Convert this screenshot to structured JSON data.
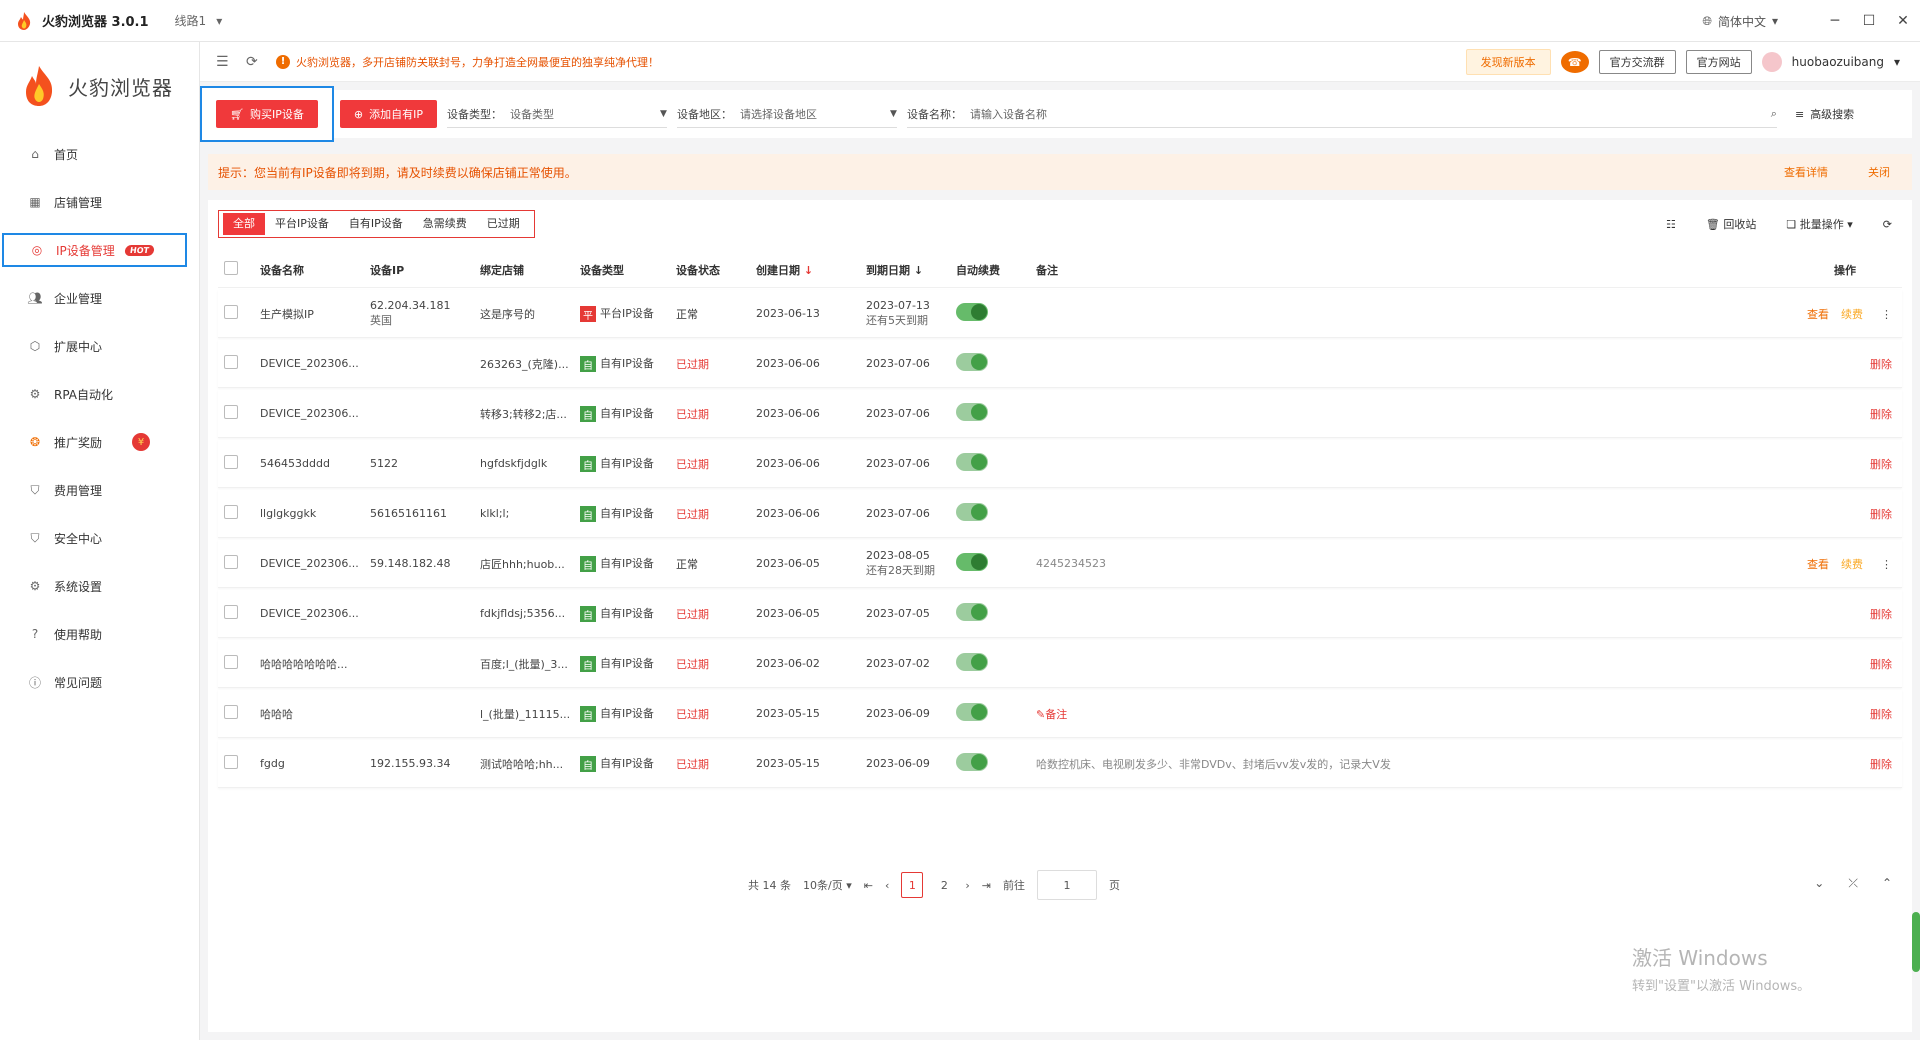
{
  "titlebar": {
    "app_title": "火豹浏览器 3.0.1",
    "route": "线路1",
    "language": "简体中文"
  },
  "brand": {
    "name": "火豹浏览器"
  },
  "sidebar": {
    "items": [
      {
        "label": "首页",
        "icon": "home-icon"
      },
      {
        "label": "店铺管理",
        "icon": "grid-icon"
      },
      {
        "label": "IP设备管理",
        "icon": "location-icon",
        "badge": "HOT"
      },
      {
        "label": "企业管理",
        "icon": "users-icon"
      },
      {
        "label": "扩展中心",
        "icon": "cube-icon"
      },
      {
        "label": "RPA自动化",
        "icon": "robot-icon"
      },
      {
        "label": "推广奖励",
        "icon": "gift-icon",
        "badge": "¥"
      },
      {
        "label": "费用管理",
        "icon": "shield-icon"
      },
      {
        "label": "安全中心",
        "icon": "shield-check-icon"
      },
      {
        "label": "系统设置",
        "icon": "settings-icon"
      },
      {
        "label": "使用帮助",
        "icon": "help-icon"
      },
      {
        "label": "常见问题",
        "icon": "info-icon"
      }
    ]
  },
  "topbar": {
    "notice": "火豹浏览器，多开店铺防关联封号，力争打造全网最便宜的独享纯净代理！",
    "new_version": "发现新版本",
    "group_btn": "官方交流群",
    "site_btn": "官方网站",
    "username": "huobaozuibang"
  },
  "toolbar": {
    "buy_btn": "购买IP设备",
    "add_btn": "添加自有IP",
    "type_label": "设备类型：",
    "type_value": "设备类型",
    "region_label": "设备地区：",
    "region_value": "请选择设备地区",
    "name_label": "设备名称：",
    "name_placeholder": "请输入设备名称",
    "advanced": "高级搜索"
  },
  "alert": {
    "text": "提示：您当前有IP设备即将到期，请及时续费以确保店铺正常使用。",
    "details": "查看详情",
    "close": "关闭"
  },
  "tabs": [
    "全部",
    "平台IP设备",
    "自有IP设备",
    "急需续费",
    "已过期"
  ],
  "panel_tools": {
    "recycle": "回收站",
    "batch": "批量操作"
  },
  "table": {
    "headers": [
      "设备名称",
      "设备IP",
      "绑定店铺",
      "设备类型",
      "设备状态",
      "创建日期",
      "到期日期",
      "自动续费",
      "备注",
      "操作"
    ],
    "rows": [
      {
        "name": "生产模拟IP",
        "ip": "62.204.34.181",
        "ip_sub": "英国",
        "shop": "这是序号的",
        "type_tag": "平",
        "type": "平台IP设备",
        "status": "正常",
        "created": "2023-06-13",
        "expire": "2023-07-13",
        "expire_sub": "还有5天到期",
        "note": "",
        "actions": [
          "查看",
          "续费"
        ]
      },
      {
        "name": "DEVICE_202306...",
        "ip": "",
        "ip_sub": "",
        "shop": "263263_(克隆)...",
        "type_tag": "自",
        "type": "自有IP设备",
        "status": "已过期",
        "created": "2023-06-06",
        "expire": "2023-07-06",
        "expire_sub": "",
        "note": "",
        "actions": [
          "删除"
        ]
      },
      {
        "name": "DEVICE_202306...",
        "ip": "",
        "ip_sub": "",
        "shop": "转移3;转移2;店...",
        "type_tag": "自",
        "type": "自有IP设备",
        "status": "已过期",
        "created": "2023-06-06",
        "expire": "2023-07-06",
        "expire_sub": "",
        "note": "",
        "actions": [
          "删除"
        ]
      },
      {
        "name": "546453dddd",
        "ip": "5122",
        "ip_sub": "",
        "shop": "hgfdskfjdglk",
        "type_tag": "自",
        "type": "自有IP设备",
        "status": "已过期",
        "created": "2023-06-06",
        "expire": "2023-07-06",
        "expire_sub": "",
        "note": "",
        "actions": [
          "删除"
        ]
      },
      {
        "name": "llglgkggkk",
        "ip": "56165161161",
        "ip_sub": "",
        "shop": "klkl;l;",
        "type_tag": "自",
        "type": "自有IP设备",
        "status": "已过期",
        "created": "2023-06-06",
        "expire": "2023-07-06",
        "expire_sub": "",
        "note": "",
        "actions": [
          "删除"
        ]
      },
      {
        "name": "DEVICE_202306...",
        "ip": "59.148.182.48",
        "ip_sub": "",
        "shop": "店匠hhh;huob...",
        "type_tag": "自",
        "type": "自有IP设备",
        "status": "正常",
        "created": "2023-06-05",
        "expire": "2023-08-05",
        "expire_sub": "还有28天到期",
        "note": "4245234523",
        "actions": [
          "查看",
          "续费"
        ]
      },
      {
        "name": "DEVICE_202306...",
        "ip": "",
        "ip_sub": "",
        "shop": "fdkjfldsj;5356...",
        "type_tag": "自",
        "type": "自有IP设备",
        "status": "已过期",
        "created": "2023-06-05",
        "expire": "2023-07-05",
        "expire_sub": "",
        "note": "",
        "actions": [
          "删除"
        ]
      },
      {
        "name": "哈哈哈哈哈哈哈...",
        "ip": "",
        "ip_sub": "",
        "shop": "百度;l_(批量)_3...",
        "type_tag": "自",
        "type": "自有IP设备",
        "status": "已过期",
        "created": "2023-06-02",
        "expire": "2023-07-02",
        "expire_sub": "",
        "note": "",
        "actions": [
          "删除"
        ]
      },
      {
        "name": "哈哈哈",
        "ip": "",
        "ip_sub": "",
        "shop": "l_(批量)_11115...",
        "type_tag": "自",
        "type": "自有IP设备",
        "status": "已过期",
        "created": "2023-05-15",
        "expire": "2023-06-09",
        "expire_sub": "",
        "note": "备注",
        "note_edit": true,
        "actions": [
          "删除"
        ]
      },
      {
        "name": "fgdg",
        "ip": "192.155.93.34",
        "ip_sub": "",
        "shop": "测试哈哈哈;hh...",
        "type_tag": "自",
        "type": "自有IP设备",
        "status": "已过期",
        "created": "2023-05-15",
        "expire": "2023-06-09",
        "expire_sub": "",
        "note": "哈数控机床、电视刷发多少、非常DVDv、封堵后vv发v发的，记录大V发",
        "actions": [
          "删除"
        ]
      }
    ]
  },
  "pager": {
    "total": "共 14 条",
    "page_size": "10条/页",
    "pages": [
      "1",
      "2"
    ],
    "goto": "前往",
    "goto_value": "1",
    "unit": "页"
  },
  "watermark": {
    "line1": "激活 Windows",
    "line2": "转到\"设置\"以激活 Windows。"
  },
  "colors": {
    "primary": "#f0393b",
    "highlight": "#1e88e5",
    "success": "#43a047",
    "warning": "#ef6c00"
  }
}
